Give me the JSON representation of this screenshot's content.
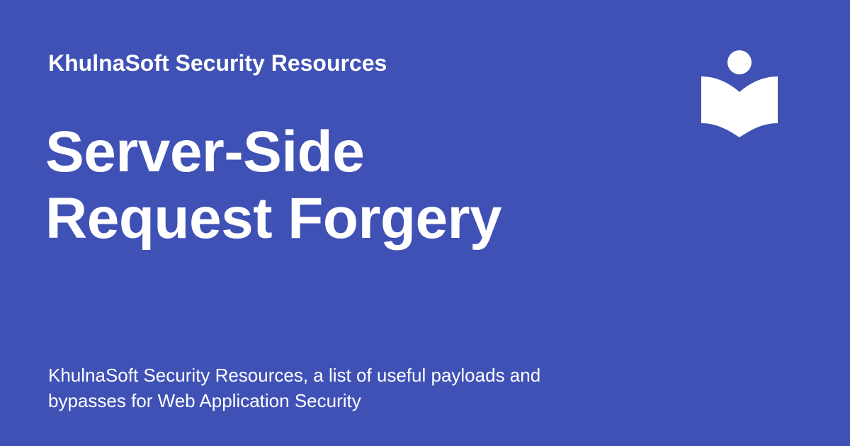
{
  "site": {
    "name": "KhulnaSoft Security Resources"
  },
  "page": {
    "title_lines": [
      "Server-Side",
      "Request Forgery"
    ],
    "description": "KhulnaSoft Security Resources, a list of useful payloads and bypasses for Web Application Security"
  },
  "logo": {
    "icon": "reading-person-book-icon"
  },
  "colors": {
    "background": "#3f51b5",
    "foreground": "#ffffff"
  }
}
